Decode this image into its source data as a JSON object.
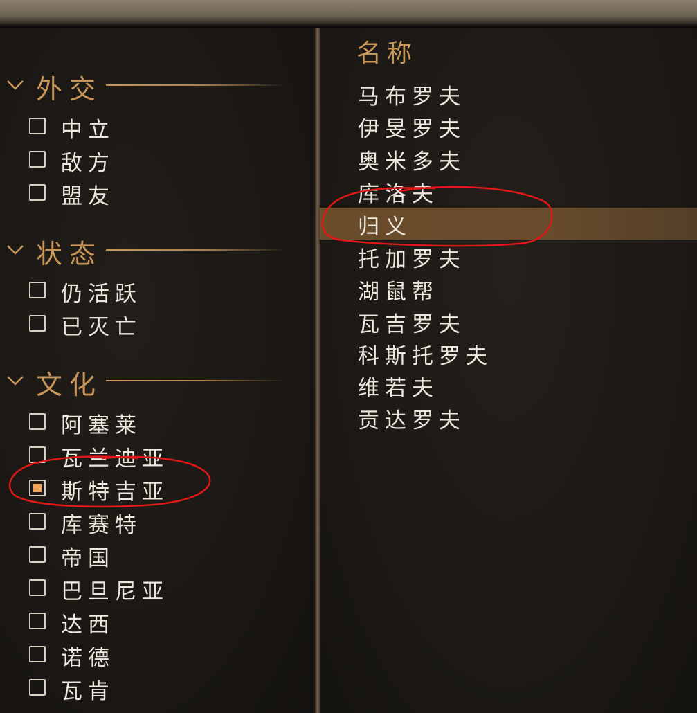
{
  "filters": {
    "sections": [
      {
        "title": "外交",
        "items": [
          {
            "label": "中立",
            "checked": false
          },
          {
            "label": "敌方",
            "checked": false
          },
          {
            "label": "盟友",
            "checked": false
          }
        ]
      },
      {
        "title": "状态",
        "items": [
          {
            "label": "仍活跃",
            "checked": false
          },
          {
            "label": "已灭亡",
            "checked": false
          }
        ]
      },
      {
        "title": "文化",
        "items": [
          {
            "label": "阿塞莱",
            "checked": false
          },
          {
            "label": "瓦兰迪亚",
            "checked": false
          },
          {
            "label": "斯特吉亚",
            "checked": true
          },
          {
            "label": "库赛特",
            "checked": false
          },
          {
            "label": "帝国",
            "checked": false
          },
          {
            "label": "巴旦尼亚",
            "checked": false
          },
          {
            "label": "达西",
            "checked": false
          },
          {
            "label": "诺德",
            "checked": false
          },
          {
            "label": "瓦肯",
            "checked": false
          }
        ]
      }
    ]
  },
  "list": {
    "header": "名称",
    "items": [
      {
        "name": "马布罗夫",
        "selected": false
      },
      {
        "name": "伊旻罗夫",
        "selected": false
      },
      {
        "name": "奥米多夫",
        "selected": false
      },
      {
        "name": "库洛夫",
        "selected": false
      },
      {
        "name": "归义",
        "selected": true
      },
      {
        "name": "托加罗夫",
        "selected": false
      },
      {
        "name": "湖鼠帮",
        "selected": false
      },
      {
        "name": "瓦吉罗夫",
        "selected": false
      },
      {
        "name": "科斯托罗夫",
        "selected": false
      },
      {
        "name": "维若夫",
        "selected": false
      },
      {
        "name": "贡达罗夫",
        "selected": false
      }
    ]
  },
  "colors": {
    "accent_gold": "#c9965a",
    "checkbox_fill": "#f0a35a",
    "selection_highlight": "#8a6436",
    "annotation_red": "#e01818"
  }
}
